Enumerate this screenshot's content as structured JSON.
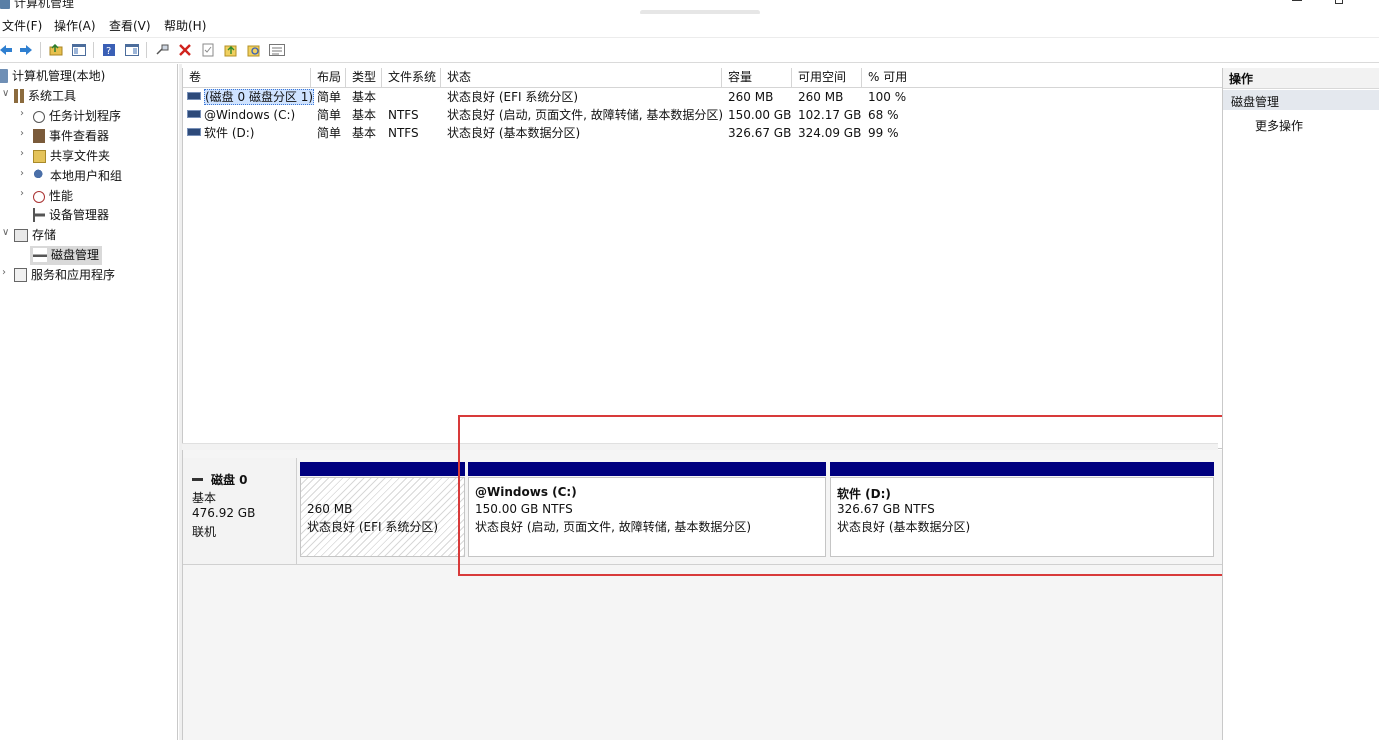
{
  "window": {
    "title": "计算机管理"
  },
  "menu": [
    {
      "label": "文件(F)"
    },
    {
      "label": "操作(A)"
    },
    {
      "label": "查看(V)"
    },
    {
      "label": "帮助(H)"
    }
  ],
  "tree": {
    "root": "计算机管理(本地)",
    "items": [
      {
        "label": "系统工具"
      },
      {
        "label": "任务计划程序"
      },
      {
        "label": "事件查看器"
      },
      {
        "label": "共享文件夹"
      },
      {
        "label": "本地用户和组"
      },
      {
        "label": "性能"
      },
      {
        "label": "设备管理器"
      },
      {
        "label": "存储"
      },
      {
        "label": "磁盘管理"
      },
      {
        "label": "服务和应用程序"
      }
    ]
  },
  "volumes": {
    "columns": [
      "卷",
      "布局",
      "类型",
      "文件系统",
      "状态",
      "容量",
      "可用空间",
      "% 可用"
    ],
    "rows": [
      [
        "(磁盘 0 磁盘分区 1)",
        "简单",
        "基本",
        "",
        "状态良好 (EFI 系统分区)",
        "260 MB",
        "260 MB",
        "100 %"
      ],
      [
        "@Windows (C:)",
        "简单",
        "基本",
        "NTFS",
        "状态良好 (启动, 页面文件, 故障转储, 基本数据分区)",
        "150.00 GB",
        "102.17 GB",
        "68 %"
      ],
      [
        "软件 (D:)",
        "简单",
        "基本",
        "NTFS",
        "状态良好 (基本数据分区)",
        "326.67 GB",
        "324.09 GB",
        "99 %"
      ]
    ]
  },
  "disk": {
    "name": "磁盘 0",
    "type": "基本",
    "size": "476.92 GB",
    "status": "联机",
    "partitions": [
      {
        "name": "",
        "size": "260 MB",
        "status": "状态良好 (EFI 系统分区)"
      },
      {
        "name": "@Windows  (C:)",
        "size": "150.00 GB NTFS",
        "status": "状态良好 (启动, 页面文件, 故障转储, 基本数据分区)"
      },
      {
        "name": "软件  (D:)",
        "size": "326.67 GB NTFS",
        "status": "状态良好 (基本数据分区)"
      }
    ]
  },
  "actions": {
    "title": "操作",
    "section": "磁盘管理",
    "more": "更多操作"
  },
  "colors": {
    "partition_bar": "#00007f",
    "highlight": "#d83a3a",
    "selection": "#cfe3ff"
  }
}
